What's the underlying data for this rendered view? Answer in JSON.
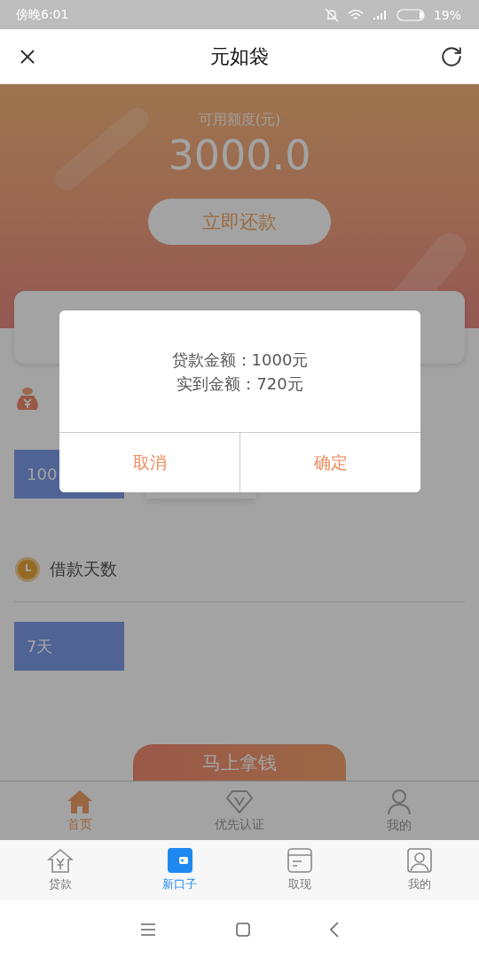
{
  "status_bar": {
    "time": "傍晚6:01",
    "battery": "19%"
  },
  "nav_bar": {
    "title": "元如袋"
  },
  "banner": {
    "label": "可用额度(元)",
    "amount": "3000.0",
    "button": "立即还款"
  },
  "sections": [
    {
      "kind": "bag",
      "chips": [
        {
          "label": "100",
          "selected": true
        },
        {
          "selected": false
        }
      ]
    },
    {
      "kind": "clock",
      "label": "借款天数",
      "chips": [
        {
          "label": "7天",
          "selected": true
        }
      ]
    }
  ],
  "submit_button": "马上拿钱",
  "page_tabs": [
    {
      "kind": "home",
      "label": "首页",
      "selected": true
    },
    {
      "kind": "diamond",
      "label": "优先认证",
      "selected": false
    },
    {
      "kind": "user",
      "label": "我的",
      "selected": false
    }
  ],
  "dialog": {
    "lines": [
      "贷款金额：1000元",
      "实到金额：720元"
    ],
    "buttons": [
      {
        "label": "取消"
      },
      {
        "label": "确定"
      }
    ]
  },
  "app_tabs": [
    {
      "kind": "loan",
      "label": "贷款",
      "selected": false
    },
    {
      "kind": "wallet",
      "label": "新口子",
      "selected": true
    },
    {
      "kind": "card",
      "label": "取现",
      "selected": false
    },
    {
      "kind": "portrait",
      "label": "我的",
      "selected": false
    }
  ]
}
